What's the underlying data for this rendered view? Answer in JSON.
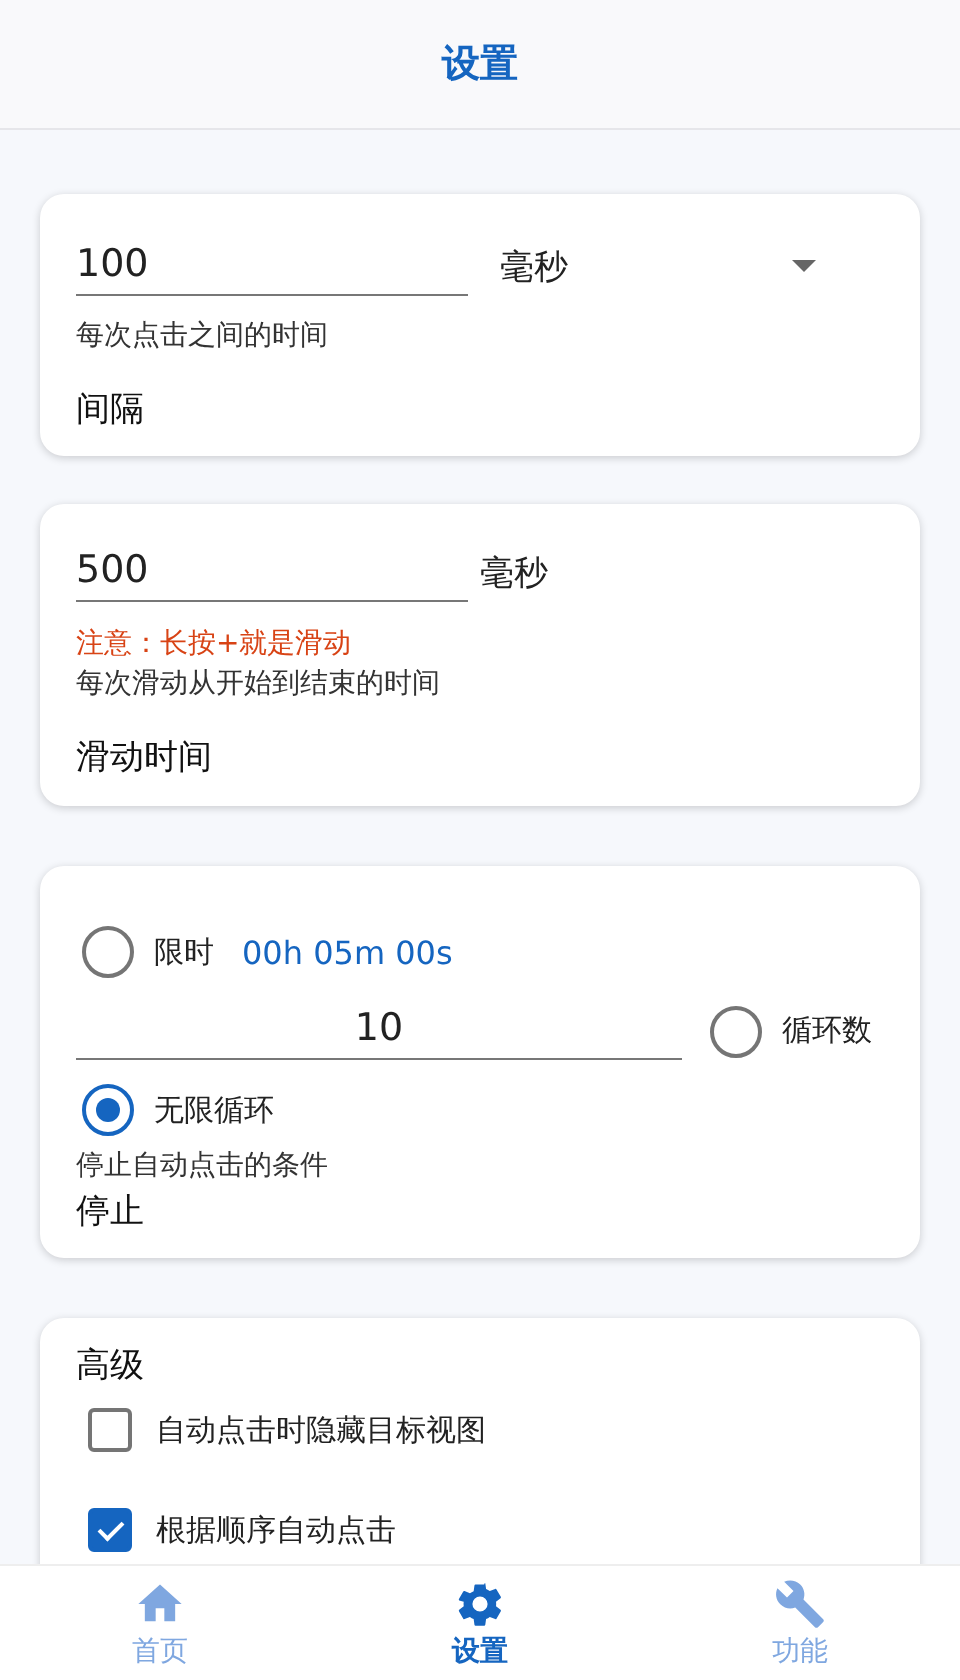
{
  "header": {
    "title": "设置"
  },
  "interval": {
    "value": "100",
    "unit": "毫秒",
    "description": "每次点击之间的时间",
    "title": "间隔"
  },
  "swipe": {
    "value": "500",
    "unit": "毫秒",
    "warning": "注意：长按+就是滑动",
    "description": "每次滑动从开始到结束的时间",
    "title": "滑动时间"
  },
  "stop": {
    "options": [
      {
        "kind": "timer",
        "label": "限时",
        "value": "00h 05m 00s",
        "selected": false
      },
      {
        "kind": "count",
        "value": "10",
        "label": "循环数",
        "selected": false
      },
      {
        "kind": "infinite",
        "label": "无限循环",
        "selected": true
      }
    ],
    "description": "停止自动点击的条件",
    "title": "停止"
  },
  "advanced": {
    "title": "高级",
    "options": [
      {
        "label": "自动点击时隐藏目标视图",
        "checked": false
      },
      {
        "label": "根据顺序自动点击",
        "checked": true
      }
    ]
  },
  "bottom_nav": [
    {
      "kind": "home",
      "label": "首页",
      "selected": false
    },
    {
      "kind": "settings",
      "label": "设置",
      "selected": true
    },
    {
      "kind": "tools",
      "label": "功能",
      "selected": false
    }
  ]
}
